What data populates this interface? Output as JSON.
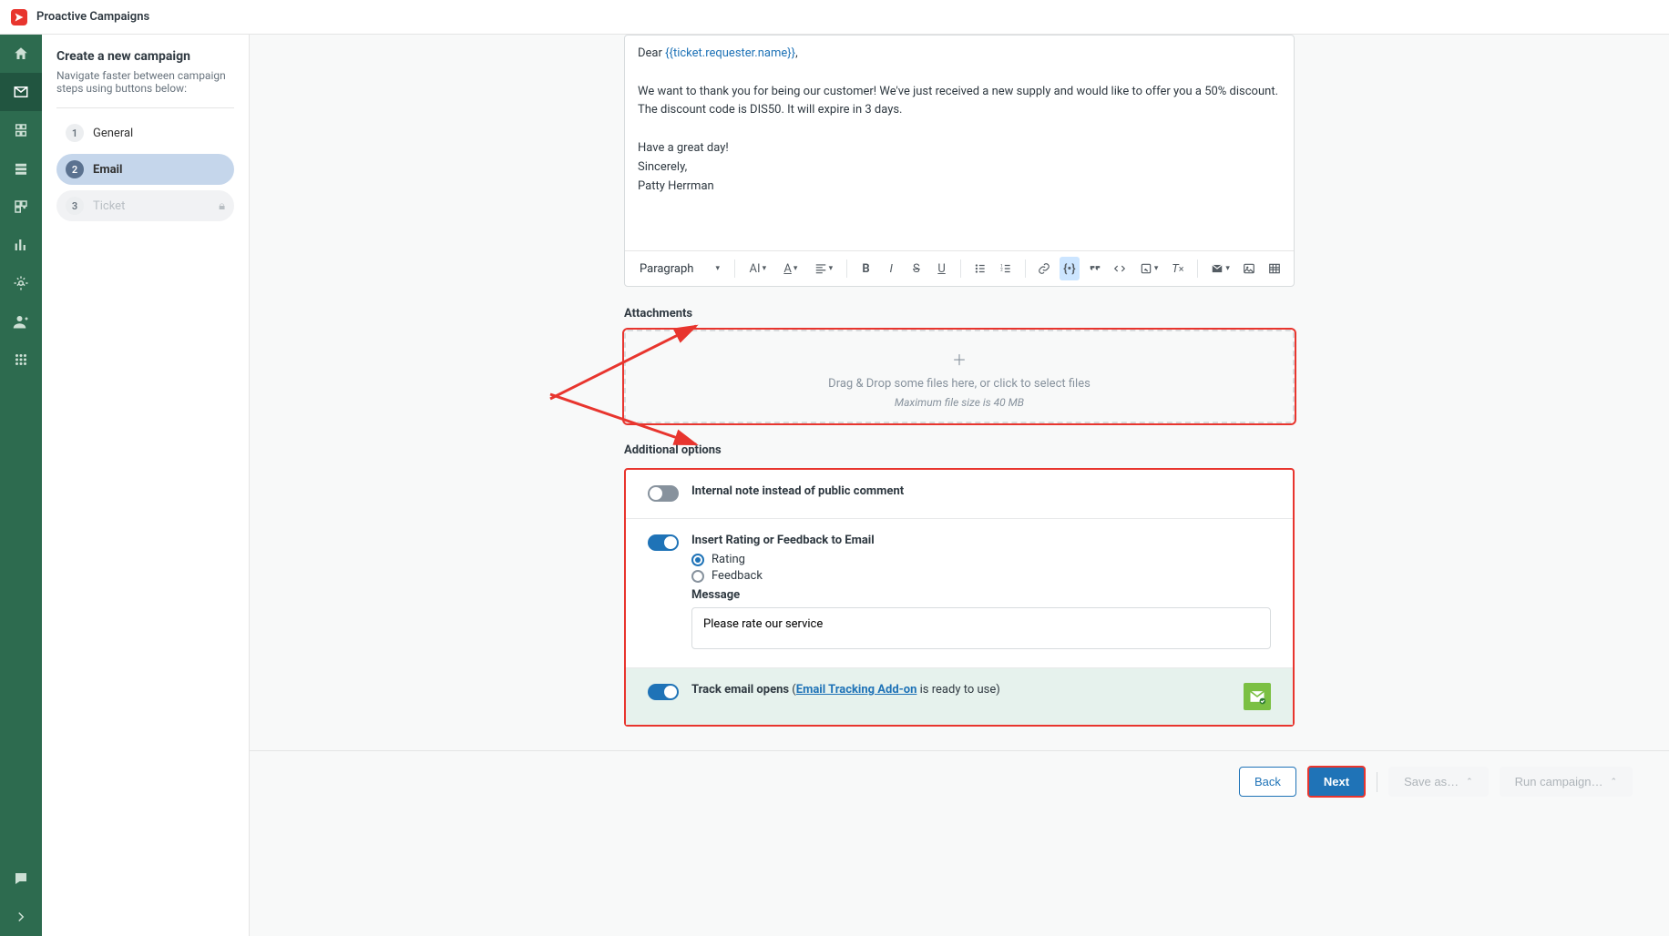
{
  "app": {
    "title": "Proactive Campaigns"
  },
  "sidebar": {
    "heading": "Create a new campaign",
    "sub": "Navigate faster between campaign steps using buttons below:",
    "steps": [
      {
        "num": "1",
        "label": "General"
      },
      {
        "num": "2",
        "label": "Email"
      },
      {
        "num": "3",
        "label": "Ticket"
      }
    ]
  },
  "email": {
    "greeting_prefix": "Dear ",
    "greeting_var": "{{ticket.requester.name}}",
    "greeting_suffix": ",",
    "body_p1": "We want to thank you for being our customer! We've just received a new supply and would like to offer you a 50% discount. The discount code is DIS50. It will expire in 3 days.",
    "body_p2": "Have a great day!",
    "body_p3": "Sincerely,",
    "body_p4": "Patty Herrman"
  },
  "toolbar": {
    "paragraph": "Paragraph",
    "ai": "AI"
  },
  "attachments": {
    "label": "Attachments",
    "dz_text": "Drag & Drop some files here, or click to select files",
    "dz_sub": "Maximum file size is 40 MB"
  },
  "options": {
    "label": "Additional options",
    "internal_note": "Internal note instead of public comment",
    "insert_rating": "Insert Rating or Feedback to Email",
    "rating": "Rating",
    "feedback": "Feedback",
    "message_label": "Message",
    "message_value": "Please rate our service",
    "track_label": "Track email opens",
    "track_paren_open": " (",
    "track_link": "Email Tracking Add-on",
    "track_paren_rest": " is ready to use)"
  },
  "footer": {
    "back": "Back",
    "next": "Next",
    "save_as": "Save as…",
    "run": "Run campaign…"
  }
}
